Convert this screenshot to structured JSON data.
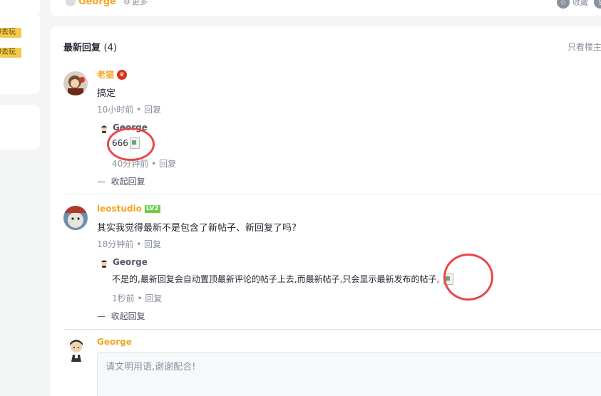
{
  "sidebar": {
    "play_label_1": "立即去玩",
    "play_label_2": "立即去玩"
  },
  "article_footer": {
    "author_name": "George",
    "more_label": "更多",
    "collect_label": "收藏"
  },
  "comments_section": {
    "title": "最新回复",
    "count": "(4)",
    "only_host_label": "只看楼主"
  },
  "comments": [
    {
      "author": "老猫",
      "content": "搞定",
      "time": "10小时前",
      "reply_label": "回复",
      "sub_reply": {
        "author": "George",
        "content": "666",
        "time": "40分钟前",
        "reply_label": "回复"
      },
      "collapse_label": "收起回复"
    },
    {
      "author": "leostudio",
      "level_badge": "LV2",
      "content": "其实我觉得最新不是包含了新帖子、新回复了吗?",
      "time": "18分钟前",
      "reply_label": "回复",
      "sub_reply": {
        "author": "George",
        "content": "不是的,最新回复会自动置顶最新评论的帖子上去,而最新帖子,只会显示最新发布的帖子,",
        "time": "1秒前",
        "reply_label": "回复"
      },
      "collapse_label": "收起回复"
    }
  ],
  "composer": {
    "user_name": "George",
    "placeholder": "请文明用语,谢谢配合!"
  },
  "colors": {
    "accent": "#f5a623",
    "highlight_circle": "#e8484b",
    "badge_red": "#d9311a",
    "level_green": "#6fcf47"
  }
}
